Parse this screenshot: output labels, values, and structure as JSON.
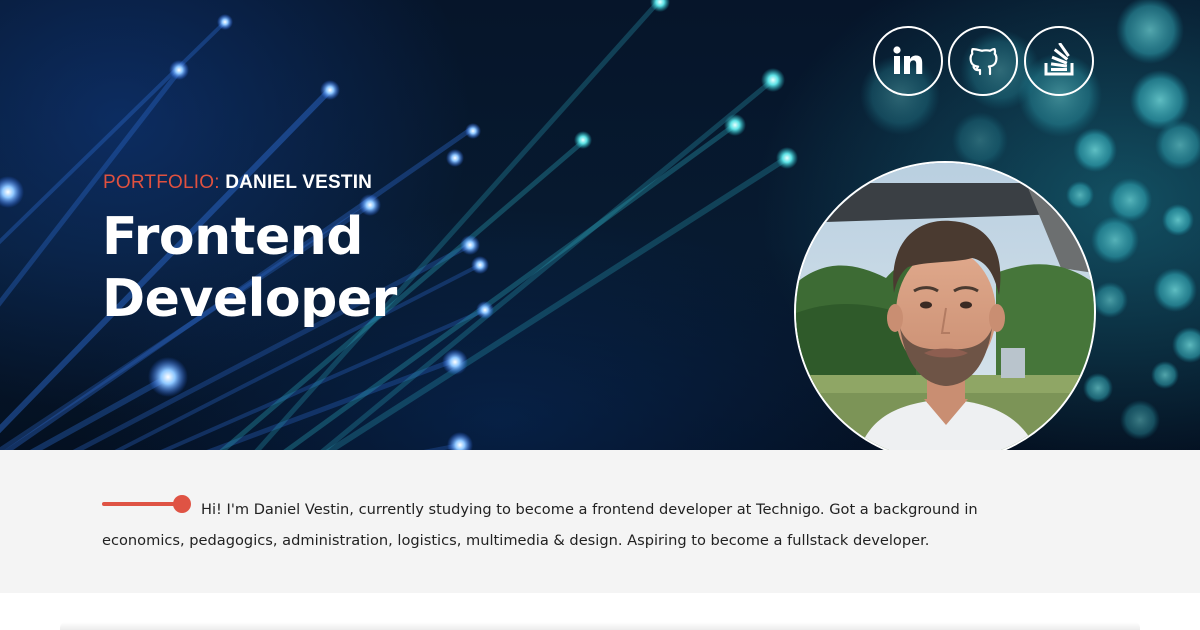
{
  "header": {
    "eyebrow_label": "PORTFOLIO:",
    "eyebrow_name": "DANIEL VESTIN",
    "title_line1": "Frontend",
    "title_line2": "Developer"
  },
  "social": [
    {
      "icon": "linkedin-icon"
    },
    {
      "icon": "github-icon"
    },
    {
      "icon": "stackoverflow-icon"
    }
  ],
  "colors": {
    "accent": "#e0513f",
    "intro_background": "#f4f4f4",
    "hero_dark": "#06152a"
  },
  "intro": {
    "text": "Hi! I'm Daniel Vestin, currently studying to become a frontend developer at Technigo. Got a background in economics, pedagogics, administration, logistics, multimedia & design. Aspiring to become a fullstack developer."
  }
}
